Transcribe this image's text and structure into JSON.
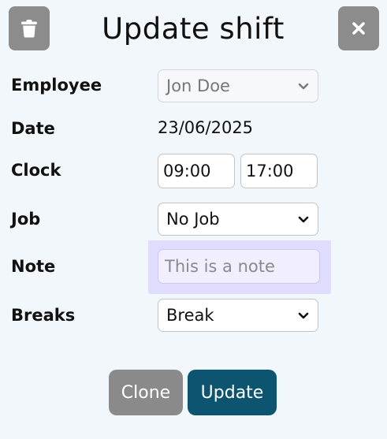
{
  "dialog": {
    "title": "Update shift"
  },
  "toolbar": {
    "delete_icon": "trash-icon",
    "close_icon": "close-icon"
  },
  "form": {
    "employee": {
      "label": "Employee",
      "value": "Jon Doe"
    },
    "date": {
      "label": "Date",
      "value": "23/06/2025"
    },
    "clock": {
      "label": "Clock",
      "start": "09:00",
      "end": "17:00"
    },
    "job": {
      "label": "Job",
      "value": "No Job"
    },
    "note": {
      "label": "Note",
      "placeholder": "This is a note",
      "value": ""
    },
    "breaks": {
      "label": "Breaks",
      "value": "Break"
    }
  },
  "actions": {
    "clone_label": "Clone",
    "update_label": "Update"
  },
  "colors": {
    "background": "#f2f7fb",
    "icon_button": "#8c8c8c",
    "clone_button": "#8a8a8a",
    "update_button": "#0c5470",
    "note_focus": "#e0dcff"
  }
}
